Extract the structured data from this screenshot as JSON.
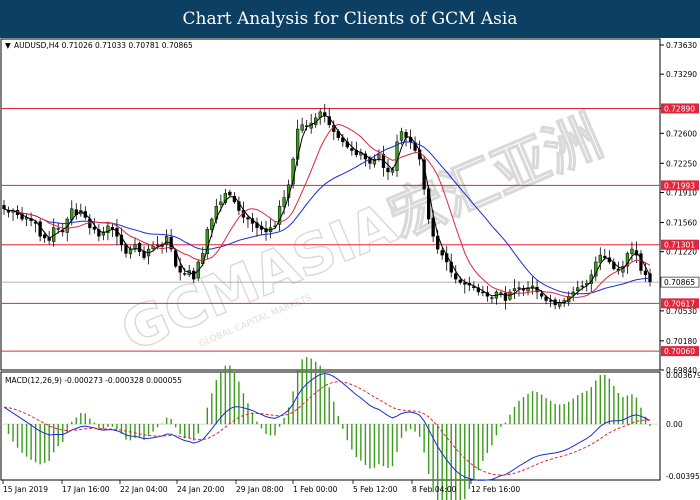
{
  "header": {
    "title": "Chart Analysis for Clients of GCM Asia"
  },
  "watermark": {
    "text": "GCMASIA宏汇亚洲",
    "subtext": "GLOBAL CAPITAL MARKETS"
  },
  "price_panel": {
    "symbol_line": "AUDUSD,H4  0.71026 0.71033 0.70781 0.70865",
    "y_ticks": [
      "0.73630",
      "0.73290",
      "0.72890",
      "0.72600",
      "0.72250",
      "0.71910",
      "0.71560",
      "0.71220",
      "0.70865",
      "0.70530",
      "0.70180",
      "0.69840"
    ],
    "current_price": "0.70865",
    "levels": [
      {
        "label": "0.72890",
        "value": 0.7289
      },
      {
        "label": "0.71993",
        "value": 0.71993
      },
      {
        "label": "0.71301",
        "value": 0.71301
      },
      {
        "label": "0.70617",
        "value": 0.70617
      },
      {
        "label": "0.70060",
        "value": 0.7006
      }
    ]
  },
  "macd_panel": {
    "label": "MACD(12,26,9) -0.000273 -0.000328 0.000055",
    "y_ticks": [
      "0.003679",
      "0.00",
      "-0.003957"
    ]
  },
  "x_labels": [
    "15 Jan 2019",
    "17 Jan 16:00",
    "22 Jan 04:00",
    "24 Jan 20:00",
    "29 Jan 08:00",
    "1 Feb 00:00",
    "5 Feb 12:00",
    "8 Feb 04:00",
    "12 Feb 16:00"
  ],
  "colors": {
    "header_bg": "#0d3f62",
    "level_line": "#e0263c",
    "level_tag": "#e0263c",
    "current_tag": "#ffffff",
    "ma_fast": "#000000",
    "ma_mid": "#e0263c",
    "ma_slow": "#1b2bd6",
    "macd_hist": "#3a9a1a",
    "macd_line": "#1b2bd6",
    "signal_line": "#e0263c",
    "bull_candle": "#3a9a1a",
    "bear_candle": "#000000"
  },
  "chart_data": {
    "type": "candlestick",
    "symbol": "AUDUSD",
    "timeframe": "H4",
    "ylim": [
      0.6984,
      0.737
    ],
    "close": [
      0.7172,
      0.7168,
      0.717,
      0.7165,
      0.716,
      0.7162,
      0.7158,
      0.7155,
      0.714,
      0.7138,
      0.7135,
      0.715,
      0.7148,
      0.7145,
      0.716,
      0.7172,
      0.7165,
      0.717,
      0.7162,
      0.715,
      0.7148,
      0.714,
      0.7145,
      0.7152,
      0.7148,
      0.714,
      0.713,
      0.712,
      0.7125,
      0.713,
      0.7122,
      0.7115,
      0.7125,
      0.7128,
      0.713,
      0.713,
      0.714,
      0.7125,
      0.7105,
      0.7098,
      0.7096,
      0.71,
      0.709,
      0.711,
      0.712,
      0.7148,
      0.716,
      0.7175,
      0.718,
      0.719,
      0.7188,
      0.718,
      0.717,
      0.7162,
      0.716,
      0.7155,
      0.715,
      0.7148,
      0.7145,
      0.715,
      0.7152,
      0.7175,
      0.7185,
      0.72,
      0.723,
      0.7265,
      0.727,
      0.7268,
      0.7272,
      0.7278,
      0.7285,
      0.728,
      0.727,
      0.7262,
      0.7255,
      0.725,
      0.7244,
      0.724,
      0.7235,
      0.7238,
      0.723,
      0.7225,
      0.723,
      0.7235,
      0.722,
      0.7215,
      0.7218,
      0.725,
      0.7262,
      0.7255,
      0.725,
      0.724,
      0.723,
      0.7195,
      0.716,
      0.714,
      0.7125,
      0.7118,
      0.711,
      0.7098,
      0.709,
      0.7086,
      0.7084,
      0.7083,
      0.708,
      0.7075,
      0.7074,
      0.707,
      0.7068,
      0.7075,
      0.7074,
      0.7065,
      0.7075,
      0.7079,
      0.708,
      0.7078,
      0.708,
      0.7082,
      0.7075,
      0.707,
      0.7065,
      0.7064,
      0.706,
      0.7063,
      0.7065,
      0.707,
      0.7075,
      0.708,
      0.7082,
      0.7085,
      0.7095,
      0.711,
      0.7118,
      0.7115,
      0.711,
      0.7102,
      0.71,
      0.7105,
      0.712,
      0.7125,
      0.7118,
      0.71,
      0.7095,
      0.7087
    ],
    "levels": [
      0.7289,
      0.71993,
      0.71301,
      0.70617,
      0.7006
    ],
    "macd": {
      "fast": 12,
      "slow": 26,
      "signal": 9,
      "main": -0.000273,
      "signal_value": -0.000328,
      "histogram": 5.5e-05,
      "ylim": [
        -0.003957,
        0.003679
      ]
    }
  }
}
